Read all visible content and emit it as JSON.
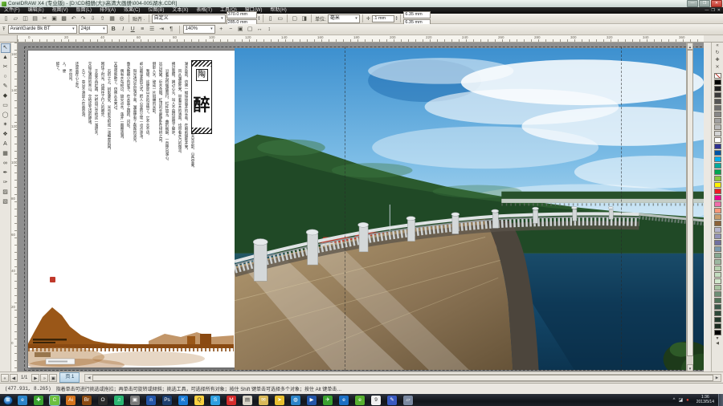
{
  "window": {
    "app_title": "CorelDRAW X4 (专业版) - [D:\\CD相册(大)\\高清大画册\\004-005湖水.CDR]",
    "controls": {
      "min": "—",
      "max": "❐",
      "close": "✕"
    }
  },
  "menu": {
    "items": [
      "文件(F)",
      "编辑(E)",
      "视图(V)",
      "版面(L)",
      "排列(A)",
      "效果(C)",
      "位图(B)",
      "文本(X)",
      "表格(T)",
      "工具(O)",
      "窗口(W)",
      "帮助(H)"
    ],
    "mdi_controls": {
      "min": "—",
      "restore": "❐",
      "close": "✕"
    }
  },
  "toolbar": {
    "std_icons": [
      {
        "name": "new-document-icon",
        "glyph": "▯"
      },
      {
        "name": "open-icon",
        "glyph": "▱"
      },
      {
        "name": "save-icon",
        "glyph": "◫"
      },
      {
        "name": "print-icon",
        "glyph": "▤"
      },
      {
        "name": "cut-icon",
        "glyph": "✂"
      },
      {
        "name": "copy-icon",
        "glyph": "▣"
      },
      {
        "name": "paste-icon",
        "glyph": "▩"
      },
      {
        "name": "undo-icon",
        "glyph": "↶"
      },
      {
        "name": "redo-icon",
        "glyph": "↷"
      },
      {
        "name": "import-icon",
        "glyph": "⇩"
      },
      {
        "name": "export-icon",
        "glyph": "⇧"
      },
      {
        "name": "app-launcher-icon",
        "glyph": "▦"
      },
      {
        "name": "corel-online-icon",
        "glyph": "◎"
      }
    ],
    "snap_label": "贴齐 ·",
    "property": {
      "preset": "自定义",
      "width": "370.0 mm",
      "height": "285.0 mm",
      "portrait_glyph": "▯",
      "landscape_glyph": "▭",
      "units_label": "单位:",
      "units": "毫米",
      "nudge": ".1 mm",
      "dup_x": "6.35 mm",
      "dup_y": "6.35 mm"
    }
  },
  "textbar": {
    "font": "AvantGarde Bk BT",
    "size": "24pt",
    "format_icons": [
      {
        "name": "bold-button",
        "glyph": "B"
      },
      {
        "name": "italic-button",
        "glyph": "I"
      },
      {
        "name": "underline-button",
        "glyph": "U"
      },
      {
        "name": "align-left-icon",
        "glyph": "≡"
      },
      {
        "name": "bullet-list-icon",
        "glyph": "☰"
      },
      {
        "name": "indent-icon",
        "glyph": "⇥"
      },
      {
        "name": "text-direction-icon",
        "glyph": "¶"
      }
    ],
    "zoom_level": "140%",
    "zoom_icons": [
      {
        "name": "zoom-in-icon",
        "glyph": "+"
      },
      {
        "name": "zoom-out-icon",
        "glyph": "−"
      },
      {
        "name": "zoom-selected-icon",
        "glyph": "▣"
      },
      {
        "name": "zoom-page-icon",
        "glyph": "▢"
      },
      {
        "name": "zoom-width-icon",
        "glyph": "↔"
      },
      {
        "name": "zoom-height-icon",
        "glyph": "↕"
      }
    ]
  },
  "rulers": {
    "h_values": [
      0,
      20,
      40,
      60,
      80,
      100,
      120,
      140,
      160,
      180,
      200,
      220,
      240,
      260,
      280,
      300,
      320,
      340,
      360
    ],
    "v_values": [
      160,
      140,
      120,
      100,
      80,
      60,
      40,
      20,
      0
    ]
  },
  "toolbox": {
    "tools": [
      {
        "name": "pick-tool",
        "glyph": "↖",
        "active": true
      },
      {
        "name": "shape-tool",
        "glyph": "▲",
        "active": false
      },
      {
        "name": "crop-tool",
        "glyph": "✂",
        "active": false
      },
      {
        "name": "zoom-tool",
        "glyph": "○",
        "active": false
      },
      {
        "name": "freehand-tool",
        "glyph": "✎",
        "active": false
      },
      {
        "name": "smart-fill-tool",
        "glyph": "◆",
        "active": false
      },
      {
        "name": "rectangle-tool",
        "glyph": "▭",
        "active": false
      },
      {
        "name": "ellipse-tool",
        "glyph": "◯",
        "active": false
      },
      {
        "name": "polygon-tool",
        "glyph": "✶",
        "active": false
      },
      {
        "name": "basic-shapes-tool",
        "glyph": "❖",
        "active": false
      },
      {
        "name": "text-tool",
        "glyph": "A",
        "active": false
      },
      {
        "name": "table-tool",
        "glyph": "▦",
        "active": false
      },
      {
        "name": "blend-tool",
        "glyph": "∞",
        "active": false
      },
      {
        "name": "eyedropper-tool",
        "glyph": "✒",
        "active": false
      },
      {
        "name": "outline-pen-tool",
        "glyph": "✑",
        "active": false
      },
      {
        "name": "fill-tool",
        "glyph": "▨",
        "active": false
      },
      {
        "name": "interactive-fill-tool",
        "glyph": "▧",
        "active": false
      }
    ]
  },
  "document": {
    "banner_top_char": "陶",
    "banner_main_char": "醉",
    "columns": [
      "　　于是，我来到一场注定的邂逅里。此时，天光云影，山色空蒙，",
      "湖水盈盈，仿佛一幅徐徐展开的长卷，在眼前铺陈开来。",
      "　　风从湖面吹来，带着草木的清香，也带着水汽的微凉，",
      "拂过面颊，拂过心头，叫人不由得放慢了脚步。",
      "　　沿着石桥缓缓而行，栏杆如玉，曲折蜿蜒，一直伸向湖心。",
      "远山如黛，近水含烟，红顶的长廊静卧在绿树之间，",
      "倒影入水，碎成一片斑斓的光影。",
      "　　我想，这便是山水的深情了。它不言不语，",
      "却以最温柔的方式，把人心里的尘埃一点点涤净。",
      "　　阳光透过云层洒下来，湖面便有了粼粼的波光，",
      "像无数细小的星子，在水面上跳跃、闪烁。",
      "　　偶有水鸟掠过，翅尖点水，荡开一圈圈涟漪，",
      "又悠悠地散了，仿佛从未来过。",
      "　　石阶之上，树影婆娑，光与影交织成一张细密的网，",
      "网住了时光，也网住了行人的脚步。",
      "　　于是不再赶路，只把自己交给这一湖碧水，",
      "交给这满目的青山，交给这无边的静谧。",
      "　　久了，竟分不清是人在画中游，",
      "还是画在心上走。",
      "　　不觉间，",
      "人，便",
      "醉了。"
    ]
  },
  "palette": {
    "swatches": [
      "none",
      "#000000",
      "#1f1f1f",
      "#3b3b3b",
      "#555555",
      "#6e6e6e",
      "#888888",
      "#a1a1a1",
      "#bababa",
      "#d4d4d4",
      "#ffffff",
      "#2e3192",
      "#0054a6",
      "#00aeef",
      "#00a99d",
      "#00a651",
      "#8dc63f",
      "#fff200",
      "#ed1c24",
      "#ec008c",
      "#f06eaa",
      "#f7977a",
      "#c69c6d",
      "#8c6239",
      "#b3b3cc",
      "#9292b8",
      "#7070a0",
      "#7a99ad",
      "#86a791",
      "#9db8a1",
      "#b5d1b0",
      "#c4ddc0",
      "#d1e8cd",
      "#a8c4a2",
      "#6d8f76",
      "#4f7359",
      "#39594a",
      "#2e4a3a",
      "#233a2d",
      "#1a2b20",
      "#000000"
    ],
    "docker_icons": [
      {
        "name": "docker-menu-icon",
        "glyph": "«"
      },
      {
        "name": "docker-refresh-icon",
        "glyph": "↻"
      },
      {
        "name": "docker-add-icon",
        "glyph": "✚"
      },
      {
        "name": "docker-close-icon",
        "glyph": "✕"
      }
    ]
  },
  "pagebar": {
    "first_glyph": "«",
    "prev_glyph": "◀",
    "count": "1/1",
    "next_glyph": "▶",
    "last_glyph": "»",
    "add_page_glyph": "▣",
    "tab_label": "页 1"
  },
  "statusbar": {
    "coords": "(477.931, 8.265)",
    "hint": "指着单击可进行挑选或拖拉；再单击可旋转或倾斜；挑选工具，可选择所有对象；按住 Shift 键单击可选择多个对象；按住 Alt 键单击…"
  },
  "taskbar": {
    "start_glyph": "⊞",
    "icons": [
      {
        "name": "taskbar-browser-globe-icon",
        "glyph": "e",
        "bg": "#2b84c9",
        "active": false
      },
      {
        "name": "taskbar-360-safety-icon",
        "glyph": "✚",
        "bg": "#3aa12f",
        "active": false
      },
      {
        "name": "taskbar-coreldraw-icon",
        "glyph": "C",
        "bg": "#6cbf3f",
        "active": true
      },
      {
        "name": "taskbar-illustrator-icon",
        "glyph": "Ai",
        "bg": "#d4731c",
        "active": false
      },
      {
        "name": "taskbar-bridge-icon",
        "glyph": "Br",
        "bg": "#8a4a12",
        "active": false
      },
      {
        "name": "taskbar-office-icon",
        "glyph": "O",
        "bg": "#2b2b2b",
        "active": false
      },
      {
        "name": "taskbar-qq-music-icon",
        "glyph": "♫",
        "bg": "#2bb673",
        "active": false
      },
      {
        "name": "taskbar-photo-viewer-icon",
        "glyph": "▣",
        "bg": "#7a7a7a",
        "active": false
      },
      {
        "name": "taskbar-netease-icon",
        "glyph": "n",
        "bg": "#2456a8",
        "active": false
      },
      {
        "name": "taskbar-photoshop-icon",
        "glyph": "Ps",
        "bg": "#1c3e6e",
        "active": false
      },
      {
        "name": "taskbar-kugou-icon",
        "glyph": "K",
        "bg": "#1a7ad4",
        "active": false
      },
      {
        "name": "taskbar-qq-icon",
        "glyph": "Q",
        "bg": "#f8d040",
        "active": false
      },
      {
        "name": "taskbar-sogou-browser-icon",
        "glyph": "S",
        "bg": "#2e9fe0",
        "active": false
      },
      {
        "name": "taskbar-m-app-icon",
        "glyph": "M",
        "bg": "#d42b2b",
        "active": false
      },
      {
        "name": "taskbar-notepad-icon",
        "glyph": "▤",
        "bg": "#d8d4c8",
        "active": false
      },
      {
        "name": "taskbar-mail-icon",
        "glyph": "✉",
        "bg": "#d8b858",
        "active": false
      },
      {
        "name": "taskbar-kankan-icon",
        "glyph": "➤",
        "bg": "#e8c030",
        "active": false
      },
      {
        "name": "taskbar-globe2-icon",
        "glyph": "◍",
        "bg": "#2b84c9",
        "active": false
      },
      {
        "name": "taskbar-player-icon",
        "glyph": "▶",
        "bg": "#2456a8",
        "active": false
      },
      {
        "name": "taskbar-green-bird-icon",
        "glyph": "✈",
        "bg": "#3aa12f",
        "active": false
      },
      {
        "name": "taskbar-ie-icon",
        "glyph": "e",
        "bg": "#1b6fc4",
        "active": false
      },
      {
        "name": "taskbar-e-green-icon",
        "glyph": "e",
        "bg": "#58b030",
        "active": false
      },
      {
        "name": "taskbar-sogou-pinyin-icon",
        "glyph": "9",
        "bg": "#f0f0f0",
        "active": false
      },
      {
        "name": "taskbar-pen-app-icon",
        "glyph": "✎",
        "bg": "#3a5ac0",
        "active": false
      },
      {
        "name": "taskbar-folder-icon",
        "glyph": "▱",
        "bg": "#7a88a0",
        "active": false
      }
    ],
    "tray_icons": [
      {
        "name": "tray-expand-icon",
        "glyph": "^"
      },
      {
        "name": "tray-app-icon",
        "glyph": "◪"
      },
      {
        "name": "tray-alert-icon",
        "glyph": "●"
      }
    ],
    "clock_time": "1:36",
    "clock_date": "2013/5/14"
  }
}
